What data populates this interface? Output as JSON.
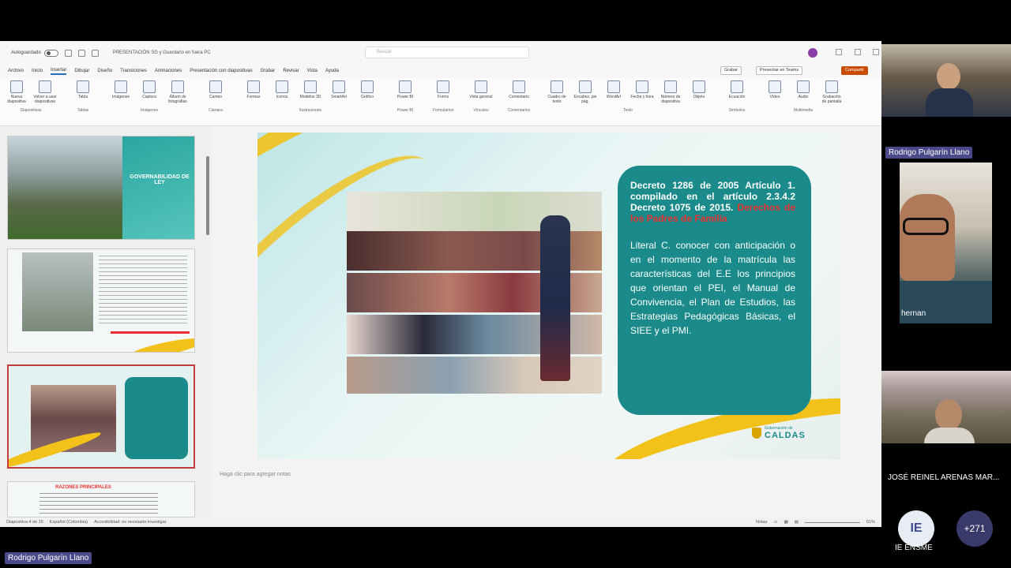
{
  "app": {
    "autosave_label": "Autoguardado",
    "doc_title": "PRESENTACIÓN SG y Guardarlo en fuera PC",
    "search_placeholder": "Buscar",
    "menu_tabs": [
      "Archivo",
      "Inicio",
      "Insertar",
      "Dibujar",
      "Diseño",
      "Transiciones",
      "Animaciones",
      "Presentación con diapositivas",
      "Grabar",
      "Revisar",
      "Vista",
      "Ayuda"
    ],
    "active_tab": "Insertar",
    "record_label": "Grabar",
    "present_label": "Presentar en Teams",
    "share_label": "Compartir"
  },
  "ribbon": {
    "groups": [
      {
        "name": "Diapositivas",
        "items": [
          "Nueva diapositiva",
          "Volver a usar diapositivas"
        ]
      },
      {
        "name": "Tablas",
        "items": [
          "Tabla"
        ]
      },
      {
        "name": "Imágenes",
        "items": [
          "Imágenes",
          "Captura",
          "Álbum de fotografías"
        ]
      },
      {
        "name": "Cámara",
        "items": [
          "Cameo"
        ]
      },
      {
        "name": "Ilustraciones",
        "items": [
          "Formas",
          "Iconos",
          "Modelos 3D",
          "SmartArt",
          "Gráfico"
        ]
      },
      {
        "name": "Power BI",
        "items": [
          "Power BI"
        ]
      },
      {
        "name": "Formularios",
        "items": [
          "Forms"
        ]
      },
      {
        "name": "Vínculos",
        "items": [
          "Vista general"
        ]
      },
      {
        "name": "Comentarios",
        "items": [
          "Comentario"
        ]
      },
      {
        "name": "Texto",
        "items": [
          "Cuadro de texto",
          "Encabez. pie pág.",
          "WordArt",
          "Fecha y hora",
          "Número de diapositiva",
          "Objeto"
        ]
      },
      {
        "name": "Símbolos",
        "items": [
          "Ecuación"
        ]
      },
      {
        "name": "Multimedia",
        "items": [
          "Vídeo",
          "Audio",
          "Grabación de pantalla"
        ]
      }
    ]
  },
  "thumbnails": {
    "slide1_title": "GOVERNABILIDAD DE LEY",
    "slide4_title": "RAZONES PRINCIPALES"
  },
  "slide": {
    "heading_black": "Decreto 1286 de 2005 Artículo 1. compilado en el artículo 2.3.4.2 Decreto 1075 de 2015.",
    "heading_red": "Derechos de los Padres de Familia",
    "body": "Literal C. conocer con anticipación o en el momento de la matrícula las características del E.E los principios que orientan el PEI, el Manual de Convivencia, el Plan de Estudios, las Estrategias Pedagógicas Básicas, el SIEE y el PMI.",
    "logo_small": "Gobernación de",
    "logo_text": "CALDAS",
    "notes_placeholder": "Haga clic para agregar notas"
  },
  "statusbar": {
    "slide_counter": "Diapositiva 4 de 15",
    "language": "Español (Colombia)",
    "accessibility": "Accesibilidad: es necesario investigar",
    "notes_label": "Notas",
    "zoom": "61%"
  },
  "participants": {
    "spotlight_name": "Rodrigo Pulgarín Llano",
    "top_right_name": "Rodrigo Pulgarín Llano",
    "tile2_name": "hernan",
    "tile3_name": "JOSÉ REINEL ARENAS MAR...",
    "ie_initials": "IE",
    "ie_name": "IE ENSME",
    "overflow_count": "+271"
  },
  "colors": {
    "teal": "#1a8a8a",
    "accent_red": "#e8322f",
    "yellow": "#f2c21a",
    "nametag": "#4a4a8a"
  }
}
